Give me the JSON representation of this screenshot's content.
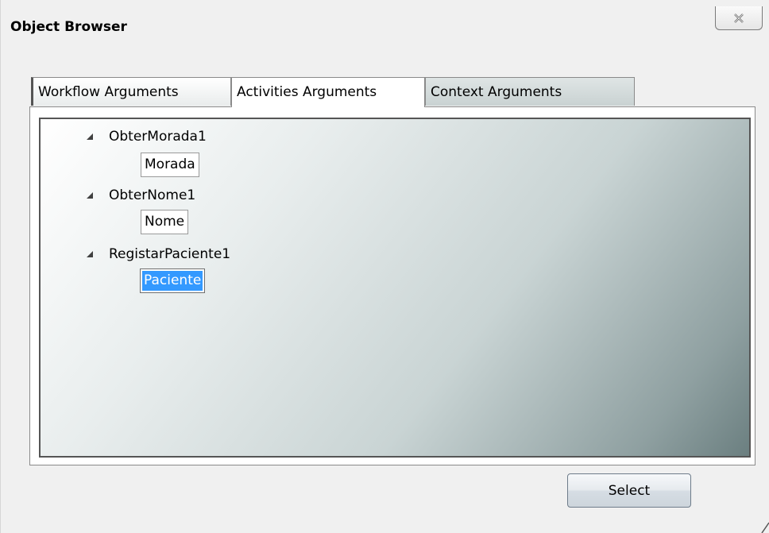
{
  "window": {
    "title": "Object Browser",
    "close_icon": "close-icon"
  },
  "tabs": [
    {
      "label": "Workflow Arguments",
      "selected": false
    },
    {
      "label": "Activities Arguments",
      "selected": true
    },
    {
      "label": "Context Arguments",
      "selected": false
    }
  ],
  "tree": [
    {
      "label": "ObterMorada1",
      "expanded": true,
      "children": [
        {
          "label": "Morada",
          "selected": false
        }
      ]
    },
    {
      "label": "ObterNome1",
      "expanded": true,
      "children": [
        {
          "label": "Nome",
          "selected": false
        }
      ]
    },
    {
      "label": "RegistarPaciente1",
      "expanded": true,
      "children": [
        {
          "label": "Paciente",
          "selected": true
        }
      ]
    }
  ],
  "buttons": {
    "select_label": "Select"
  },
  "colors": {
    "selection": "#3399ff",
    "panel_dark": "#6b7f80"
  }
}
